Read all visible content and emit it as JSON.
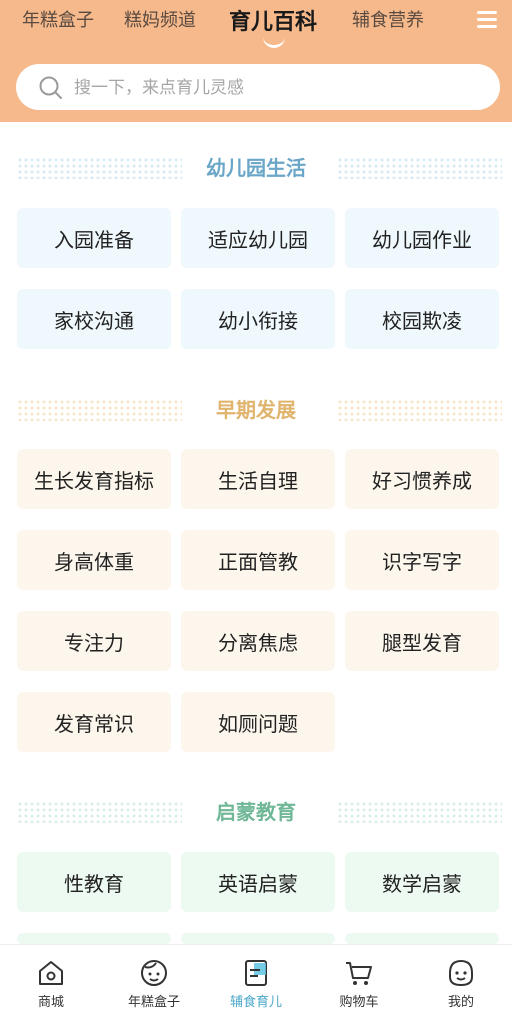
{
  "top_tabs": [
    "年糕盒子",
    "糕妈频道",
    "育儿百科",
    "辅食营养"
  ],
  "search": {
    "placeholder": "搜一下，来点育儿灵感"
  },
  "sections": [
    {
      "title": "幼儿园生活",
      "items": [
        "入园准备",
        "适应幼儿园",
        "幼儿园作业",
        "家校沟通",
        "幼小衔接",
        "校园欺凌"
      ]
    },
    {
      "title": "早期发展",
      "items": [
        "生长发育指标",
        "生活自理",
        "好习惯养成",
        "身高体重",
        "正面管教",
        "识字写字",
        "专注力",
        "分离焦虑",
        "腿型发育",
        "发育常识",
        "如厕问题"
      ]
    },
    {
      "title": "启蒙教育",
      "items": [
        "性教育",
        "英语启蒙",
        "数学启蒙"
      ]
    }
  ],
  "tabbar": [
    {
      "label": "商城",
      "icon": "store-icon"
    },
    {
      "label": "年糕盒子",
      "icon": "box-face-icon"
    },
    {
      "label": "辅食育儿",
      "icon": "book-icon"
    },
    {
      "label": "购物车",
      "icon": "cart-icon"
    },
    {
      "label": "我的",
      "icon": "profile-icon"
    }
  ],
  "colors": {
    "header_bg": "#f6b98c",
    "section1_accent": "#6aa6c7",
    "section2_accent": "#e0b46d",
    "section3_accent": "#6fb796",
    "tabbar_active": "#4aa8c7"
  }
}
